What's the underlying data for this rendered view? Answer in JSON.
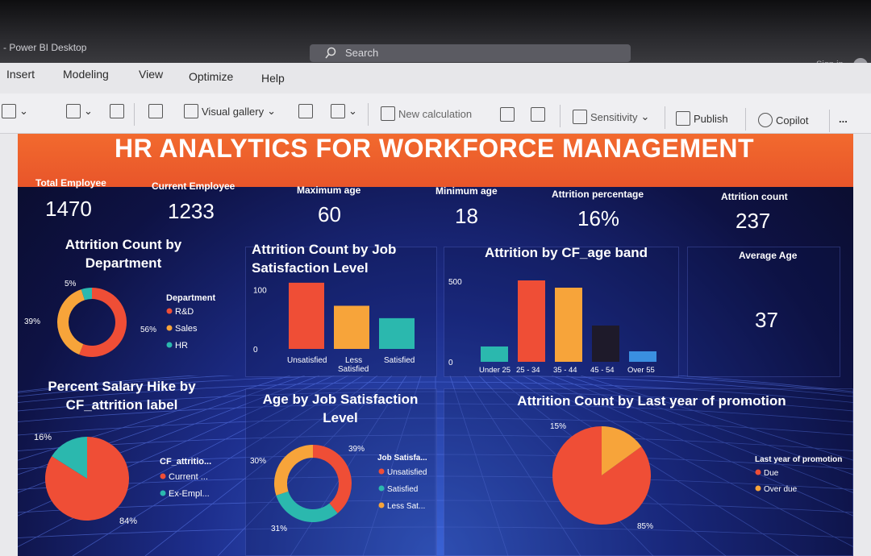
{
  "app": {
    "title": "- Power BI Desktop",
    "search_placeholder": "Search",
    "signin": "Sign in"
  },
  "menu": [
    "Insert",
    "Modeling",
    "View",
    "Optimize",
    "Help"
  ],
  "ribbon": {
    "visual_gallery": "Visual gallery",
    "new_calculation": "New calculation",
    "sensitivity": "Sensitivity",
    "publish": "Publish",
    "copilot": "Copilot",
    "more": "..."
  },
  "report": {
    "title": "HR  ANALYTICS FOR WORKFORCE MANAGEMENT",
    "kpis": [
      {
        "label": "Total Employee",
        "value": "1470"
      },
      {
        "label": "Current Employee",
        "value": "1233"
      },
      {
        "label": "Maximum age",
        "value": "60"
      },
      {
        "label": "Minimum age",
        "value": "18"
      },
      {
        "label": "Attrition percentage",
        "value": "16%"
      },
      {
        "label": "Attrition count",
        "value": "237"
      }
    ],
    "average_age": {
      "label": "Average Age",
      "value": "37"
    },
    "colors": {
      "red": "#ef4e36",
      "orange": "#f7a43a",
      "teal": "#2bb8ae",
      "blue": "#3a8fe0",
      "dark": "#1e1a2a"
    }
  },
  "chart_data": [
    {
      "id": "dept",
      "type": "pie",
      "donut": true,
      "title": "Attrition Count by Department",
      "legend_title": "Department",
      "legend": [
        "R&D",
        "Sales",
        "HR"
      ],
      "values": [
        56,
        39,
        5
      ],
      "labels": [
        "56%",
        "39%",
        "5%"
      ]
    },
    {
      "id": "jobsat",
      "type": "bar",
      "title": "Attrition Count by Job Satisfaction Level",
      "categories": [
        "Unsatisfied",
        "Less Satisfied",
        "Satisfied"
      ],
      "values": [
        112,
        73,
        52
      ],
      "ylim": [
        0,
        150
      ],
      "ticks": [
        "0",
        "100"
      ]
    },
    {
      "id": "ageband",
      "type": "bar",
      "title": "Attrition by CF_age band",
      "categories": [
        "Under 25",
        "25 - 34",
        "35 - 44",
        "45 - 54",
        "Over 55"
      ],
      "values": [
        95,
        505,
        460,
        225,
        65
      ],
      "ylim": [
        0,
        550
      ],
      "ticks": [
        "0",
        "500"
      ]
    },
    {
      "id": "salary",
      "type": "pie",
      "title": "Percent Salary Hike by CF_attrition label",
      "legend_title": "CF_attritio...",
      "legend": [
        "Current ...",
        "Ex-Empl..."
      ],
      "values": [
        84,
        16
      ],
      "labels": [
        "84%",
        "16%"
      ]
    },
    {
      "id": "agejob",
      "type": "pie",
      "donut": true,
      "title": "Age by Job Satisfaction Level",
      "legend_title": "Job Satisfa...",
      "legend": [
        "Unsatisfied",
        "Satisfied",
        "Less Sat..."
      ],
      "values": [
        39,
        31,
        30
      ],
      "labels": [
        "39%",
        "31%",
        "30%"
      ]
    },
    {
      "id": "promo",
      "type": "pie",
      "title": "Attrition Count by Last year of promotion",
      "legend_title": "Last year of promotion",
      "legend": [
        "Due",
        "Over due"
      ],
      "values": [
        85,
        15
      ],
      "labels": [
        "85%",
        "15%"
      ]
    }
  ]
}
